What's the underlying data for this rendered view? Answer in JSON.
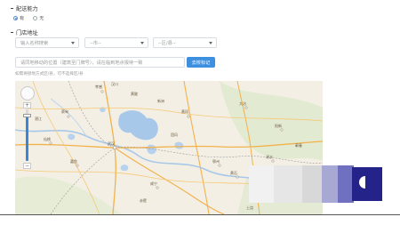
{
  "delivery": {
    "section_title": "配送能力",
    "options": [
      {
        "label": "有",
        "selected": true
      },
      {
        "label": "无",
        "selected": false
      }
    ]
  },
  "address": {
    "section_title": "门店地址",
    "search_placeholder": "输入名称搜索",
    "province_select": "--市--",
    "district_select": "--区/县--",
    "detail_placeholder": "请同地移动的位置（建筑至门牌号），请在临到地点报待一致",
    "locate_button": "去校标记",
    "hint": "如需将接地方式区/县，可不选择区/县"
  },
  "map": {
    "zoom_in": "+",
    "zoom_out": "−",
    "cities": [
      "孝感",
      "汉川",
      "武汉",
      "蔡甸",
      "黄冈",
      "鄂州",
      "黄石",
      "咸宁",
      "嘉鱼",
      "仙桃",
      "潜江",
      "赤壁",
      "大冶",
      "阳新",
      "浠水",
      "蕲春",
      "团风",
      "新洲",
      "黄陂",
      "上饶"
    ]
  },
  "colors": {
    "accent": "#3d8fe0",
    "lake": "#a8c8ea",
    "map_bg": "#f3efe5",
    "highway": "#f2b24c"
  }
}
